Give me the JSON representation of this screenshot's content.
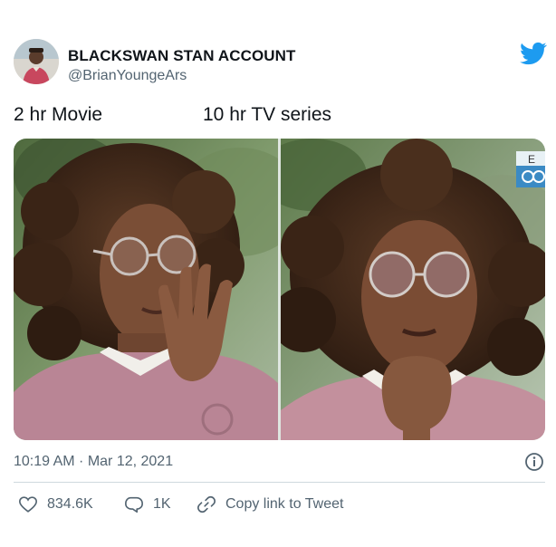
{
  "author": {
    "display_name": "BLACKSWAN STAN ACCOUNT",
    "handle": "@BrianYoungeArs"
  },
  "caption": {
    "left": "2 hr Movie",
    "right": "10 hr TV series"
  },
  "media": {
    "overlay_text": "E"
  },
  "timestamp": "10:19 AM · Mar 12, 2021",
  "actions": {
    "likes": "834.6K",
    "replies": "1K",
    "copy_link": "Copy link to Tweet"
  },
  "icons": {
    "brand": "twitter-bird-icon",
    "like": "heart-icon",
    "reply": "reply-bubble-icon",
    "copy": "link-icon",
    "info": "info-icon"
  },
  "colors": {
    "brand_blue": "#1d9bf0",
    "secondary_text": "#536471",
    "divider": "#cfd9de"
  }
}
